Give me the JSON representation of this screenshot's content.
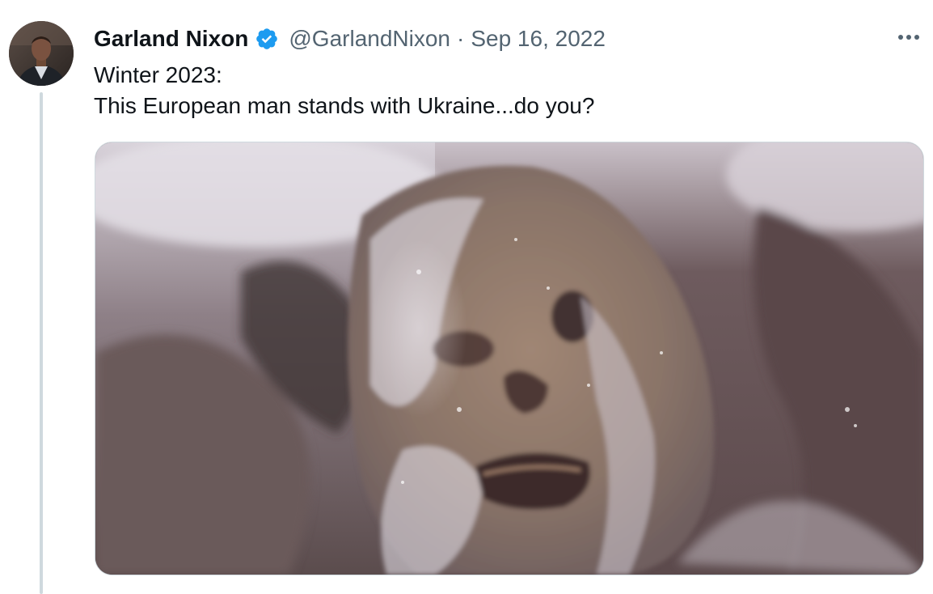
{
  "tweet": {
    "display_name": "Garland Nixon",
    "handle": "@GarlandNixon",
    "separator": "·",
    "date": "Sep 16, 2022",
    "text_lines": [
      "Winter 2023:",
      "This European man stands with Ukraine...do you?"
    ]
  },
  "icons": {
    "verified": "verified-badge-icon",
    "more": "more-horizontal-icon"
  },
  "colors": {
    "verified_blue": "#1d9bf0",
    "text_primary": "#0f1419",
    "text_secondary": "#536471",
    "border": "#cfd9de"
  }
}
